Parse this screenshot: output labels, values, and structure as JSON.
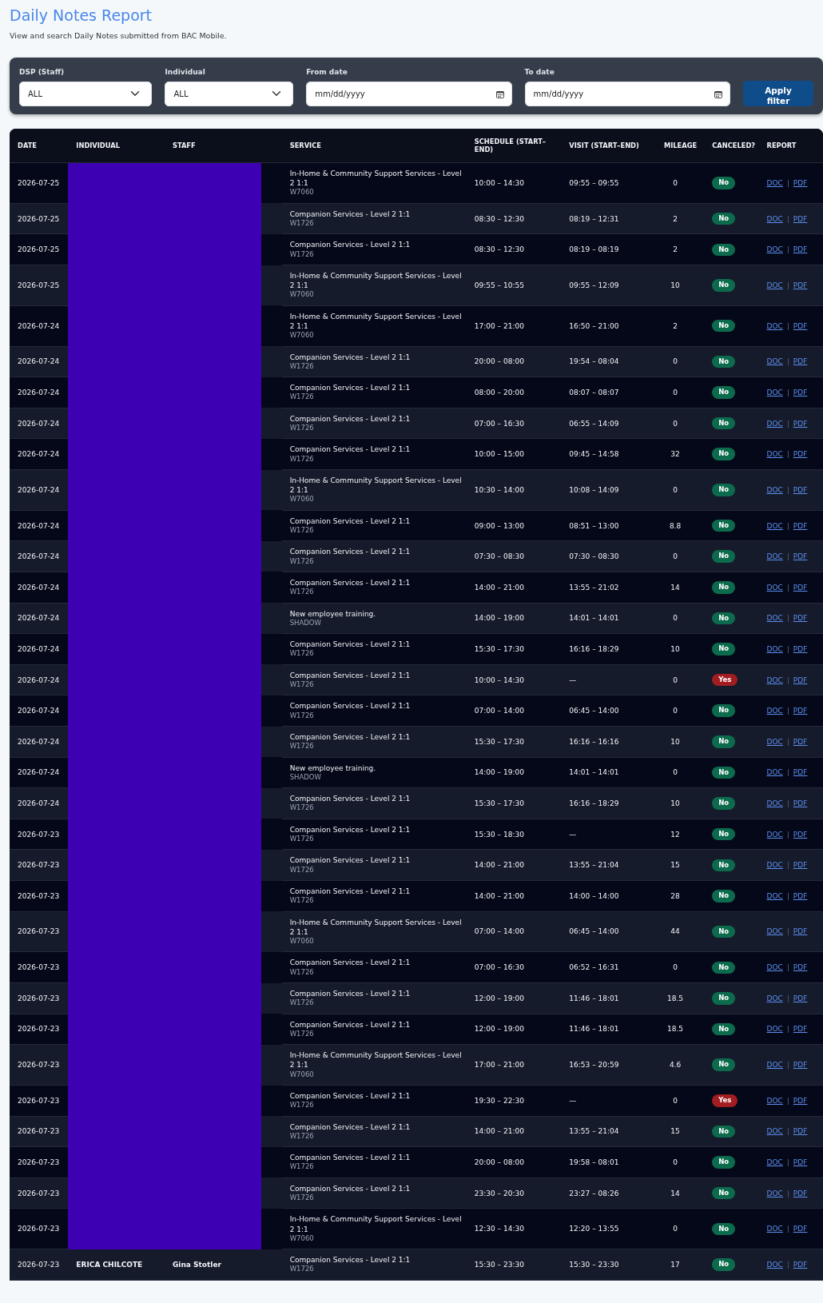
{
  "header": {
    "title": "Daily Notes Report",
    "subtitle": "View and search Daily Notes submitted from BAC Mobile."
  },
  "filters": {
    "fields": [
      {
        "kind": "select",
        "label": "DSP (Staff)",
        "value": "ALL"
      },
      {
        "kind": "select",
        "label": "Individual",
        "value": "ALL"
      },
      {
        "kind": "date",
        "label": "From date",
        "placeholder": "mm/dd/yyyy"
      },
      {
        "kind": "date",
        "label": "To date",
        "placeholder": "mm/dd/yyyy"
      }
    ],
    "button": "Apply filter"
  },
  "table": {
    "columns": [
      "DATE",
      "INDIVIDUAL",
      "STAFF",
      "SERVICE",
      "SCHEDULE (START–END)",
      "VISIT (START–END)",
      "MILEAGE",
      "CANCELED?",
      "REPORT"
    ],
    "rows": [
      {
        "date": "2026-07-25",
        "redacted": true,
        "service": "In-Home & Community Support Services - Level 2 1:1",
        "code": "W7060",
        "schedule": "10:00 – 14:30",
        "visit": "09:55 – 09:55",
        "mileage": "0",
        "canceled": false,
        "canceled_label": "No",
        "links": [
          "DOC",
          "PDF"
        ]
      },
      {
        "date": "2026-07-25",
        "redacted": true,
        "service": "Companion Services - Level 2 1:1",
        "code": "W1726",
        "schedule": "08:30 – 12:30",
        "visit": "08:19 – 12:31",
        "mileage": "2",
        "canceled": false,
        "canceled_label": "No",
        "links": [
          "DOC",
          "PDF"
        ]
      },
      {
        "date": "2026-07-25",
        "redacted": true,
        "service": "Companion Services - Level 2 1:1",
        "code": "W1726",
        "schedule": "08:30 – 12:30",
        "visit": "08:19 – 08:19",
        "mileage": "2",
        "canceled": false,
        "canceled_label": "No",
        "links": [
          "DOC",
          "PDF"
        ]
      },
      {
        "date": "2026-07-25",
        "redacted": true,
        "service": "In-Home & Community Support Services - Level 2 1:1",
        "code": "W7060",
        "schedule": "09:55 – 10:55",
        "visit": "09:55 – 12:09",
        "mileage": "10",
        "canceled": false,
        "canceled_label": "No",
        "links": [
          "DOC",
          "PDF"
        ]
      },
      {
        "date": "2026-07-24",
        "redacted": true,
        "service": "In-Home & Community Support Services - Level 2 1:1",
        "code": "W7060",
        "schedule": "17:00 – 21:00",
        "visit": "16:50 – 21:00",
        "mileage": "2",
        "canceled": false,
        "canceled_label": "No",
        "links": [
          "DOC",
          "PDF"
        ]
      },
      {
        "date": "2026-07-24",
        "redacted": true,
        "service": "Companion Services - Level 2 1:1",
        "code": "W1726",
        "schedule": "20:00 – 08:00",
        "visit": "19:54 – 08:04",
        "mileage": "0",
        "canceled": false,
        "canceled_label": "No",
        "links": [
          "DOC",
          "PDF"
        ]
      },
      {
        "date": "2026-07-24",
        "redacted": true,
        "service": "Companion Services - Level 2 1:1",
        "code": "W1726",
        "schedule": "08:00 – 20:00",
        "visit": "08:07 – 08:07",
        "mileage": "0",
        "canceled": false,
        "canceled_label": "No",
        "links": [
          "DOC",
          "PDF"
        ]
      },
      {
        "date": "2026-07-24",
        "redacted": true,
        "service": "Companion Services - Level 2 1:1",
        "code": "W1726",
        "schedule": "07:00 – 16:30",
        "visit": "06:55 – 14:09",
        "mileage": "0",
        "canceled": false,
        "canceled_label": "No",
        "links": [
          "DOC",
          "PDF"
        ]
      },
      {
        "date": "2026-07-24",
        "redacted": true,
        "service": "Companion Services - Level 2 1:1",
        "code": "W1726",
        "schedule": "10:00 – 15:00",
        "visit": "09:45 – 14:58",
        "mileage": "32",
        "canceled": false,
        "canceled_label": "No",
        "links": [
          "DOC",
          "PDF"
        ]
      },
      {
        "date": "2026-07-24",
        "redacted": true,
        "service": "In-Home & Community Support Services - Level 2 1:1",
        "code": "W7060",
        "schedule": "10:30 – 14:00",
        "visit": "10:08 – 14:09",
        "mileage": "0",
        "canceled": false,
        "canceled_label": "No",
        "links": [
          "DOC",
          "PDF"
        ]
      },
      {
        "date": "2026-07-24",
        "redacted": true,
        "service": "Companion Services - Level 2 1:1",
        "code": "W1726",
        "schedule": "09:00 – 13:00",
        "visit": "08:51 – 13:00",
        "mileage": "8.8",
        "canceled": false,
        "canceled_label": "No",
        "links": [
          "DOC",
          "PDF"
        ]
      },
      {
        "date": "2026-07-24",
        "redacted": true,
        "service": "Companion Services - Level 2 1:1",
        "code": "W1726",
        "schedule": "07:30 – 08:30",
        "visit": "07:30 – 08:30",
        "mileage": "0",
        "canceled": false,
        "canceled_label": "No",
        "links": [
          "DOC",
          "PDF"
        ]
      },
      {
        "date": "2026-07-24",
        "redacted": true,
        "service": "Companion Services - Level 2 1:1",
        "code": "W1726",
        "schedule": "14:00 – 21:00",
        "visit": "13:55 – 21:02",
        "mileage": "14",
        "canceled": false,
        "canceled_label": "No",
        "links": [
          "DOC",
          "PDF"
        ]
      },
      {
        "date": "2026-07-24",
        "redacted": true,
        "service": "New employee training.",
        "code": "SHADOW",
        "schedule": "14:00 – 19:00",
        "visit": "14:01 – 14:01",
        "mileage": "0",
        "canceled": false,
        "canceled_label": "No",
        "links": [
          "DOC",
          "PDF"
        ]
      },
      {
        "date": "2026-07-24",
        "redacted": true,
        "service": "Companion Services - Level 2 1:1",
        "code": "W1726",
        "schedule": "15:30 – 17:30",
        "visit": "16:16 – 18:29",
        "mileage": "10",
        "canceled": false,
        "canceled_label": "No",
        "links": [
          "DOC",
          "PDF"
        ]
      },
      {
        "date": "2026-07-24",
        "redacted": true,
        "service": "Companion Services - Level 2 1:1",
        "code": "W1726",
        "schedule": "10:00 – 14:30",
        "visit": "—",
        "mileage": "0",
        "canceled": true,
        "canceled_label": "Yes",
        "links": [
          "DOC",
          "PDF"
        ]
      },
      {
        "date": "2026-07-24",
        "redacted": true,
        "service": "Companion Services - Level 2 1:1",
        "code": "W1726",
        "schedule": "07:00 – 14:00",
        "visit": "06:45 – 14:00",
        "mileage": "0",
        "canceled": false,
        "canceled_label": "No",
        "links": [
          "DOC",
          "PDF"
        ]
      },
      {
        "date": "2026-07-24",
        "redacted": true,
        "service": "Companion Services - Level 2 1:1",
        "code": "W1726",
        "schedule": "15:30 – 17:30",
        "visit": "16:16 – 16:16",
        "mileage": "10",
        "canceled": false,
        "canceled_label": "No",
        "links": [
          "DOC",
          "PDF"
        ]
      },
      {
        "date": "2026-07-24",
        "redacted": true,
        "service": "New employee training.",
        "code": "SHADOW",
        "schedule": "14:00 – 19:00",
        "visit": "14:01 – 14:01",
        "mileage": "0",
        "canceled": false,
        "canceled_label": "No",
        "links": [
          "DOC",
          "PDF"
        ]
      },
      {
        "date": "2026-07-24",
        "redacted": true,
        "service": "Companion Services - Level 2 1:1",
        "code": "W1726",
        "schedule": "15:30 – 17:30",
        "visit": "16:16 – 18:29",
        "mileage": "10",
        "canceled": false,
        "canceled_label": "No",
        "links": [
          "DOC",
          "PDF"
        ]
      },
      {
        "date": "2026-07-23",
        "redacted": true,
        "service": "Companion Services - Level 2 1:1",
        "code": "W1726",
        "schedule": "15:30 – 18:30",
        "visit": "—",
        "mileage": "12",
        "canceled": false,
        "canceled_label": "No",
        "links": [
          "DOC",
          "PDF"
        ]
      },
      {
        "date": "2026-07-23",
        "redacted": true,
        "service": "Companion Services - Level 2 1:1",
        "code": "W1726",
        "schedule": "14:00 – 21:00",
        "visit": "13:55 – 21:04",
        "mileage": "15",
        "canceled": false,
        "canceled_label": "No",
        "links": [
          "DOC",
          "PDF"
        ]
      },
      {
        "date": "2026-07-23",
        "redacted": true,
        "service": "Companion Services - Level 2 1:1",
        "code": "W1726",
        "schedule": "14:00 – 21:00",
        "visit": "14:00 – 14:00",
        "mileage": "28",
        "canceled": false,
        "canceled_label": "No",
        "links": [
          "DOC",
          "PDF"
        ]
      },
      {
        "date": "2026-07-23",
        "redacted": true,
        "service": "In-Home & Community Support Services - Level 2 1:1",
        "code": "W7060",
        "schedule": "07:00 – 14:00",
        "visit": "06:45 – 14:00",
        "mileage": "44",
        "canceled": false,
        "canceled_label": "No",
        "links": [
          "DOC",
          "PDF"
        ]
      },
      {
        "date": "2026-07-23",
        "redacted": true,
        "service": "Companion Services - Level 2 1:1",
        "code": "W1726",
        "schedule": "07:00 – 16:30",
        "visit": "06:52 – 16:31",
        "mileage": "0",
        "canceled": false,
        "canceled_label": "No",
        "links": [
          "DOC",
          "PDF"
        ]
      },
      {
        "date": "2026-07-23",
        "redacted": true,
        "service": "Companion Services - Level 2 1:1",
        "code": "W1726",
        "schedule": "12:00 – 19:00",
        "visit": "11:46 – 18:01",
        "mileage": "18.5",
        "canceled": false,
        "canceled_label": "No",
        "links": [
          "DOC",
          "PDF"
        ]
      },
      {
        "date": "2026-07-23",
        "redacted": true,
        "service": "Companion Services - Level 2 1:1",
        "code": "W1726",
        "schedule": "12:00 – 19:00",
        "visit": "11:46 – 18:01",
        "mileage": "18.5",
        "canceled": false,
        "canceled_label": "No",
        "links": [
          "DOC",
          "PDF"
        ]
      },
      {
        "date": "2026-07-23",
        "redacted": true,
        "service": "In-Home & Community Support Services - Level 2 1:1",
        "code": "W7060",
        "schedule": "17:00 – 21:00",
        "visit": "16:53 – 20:59",
        "mileage": "4.6",
        "canceled": false,
        "canceled_label": "No",
        "links": [
          "DOC",
          "PDF"
        ]
      },
      {
        "date": "2026-07-23",
        "redacted": true,
        "service": "Companion Services - Level 2 1:1",
        "code": "W1726",
        "schedule": "19:30 – 22:30",
        "visit": "—",
        "mileage": "0",
        "canceled": true,
        "canceled_label": "Yes",
        "links": [
          "DOC",
          "PDF"
        ]
      },
      {
        "date": "2026-07-23",
        "redacted": true,
        "service": "Companion Services - Level 2 1:1",
        "code": "W1726",
        "schedule": "14:00 – 21:00",
        "visit": "13:55 – 21:04",
        "mileage": "15",
        "canceled": false,
        "canceled_label": "No",
        "links": [
          "DOC",
          "PDF"
        ]
      },
      {
        "date": "2026-07-23",
        "redacted": true,
        "service": "Companion Services - Level 2 1:1",
        "code": "W1726",
        "schedule": "20:00 – 08:00",
        "visit": "19:58 – 08:01",
        "mileage": "0",
        "canceled": false,
        "canceled_label": "No",
        "links": [
          "DOC",
          "PDF"
        ]
      },
      {
        "date": "2026-07-23",
        "redacted": true,
        "service": "Companion Services - Level 2 1:1",
        "code": "W1726",
        "schedule": "23:30 – 20:30",
        "visit": "23:27 – 08:26",
        "mileage": "14",
        "canceled": false,
        "canceled_label": "No",
        "links": [
          "DOC",
          "PDF"
        ]
      },
      {
        "date": "2026-07-23",
        "redacted": true,
        "service": "In-Home & Community Support Services - Level 2 1:1",
        "code": "W7060",
        "schedule": "12:30 – 14:30",
        "visit": "12:20 – 13:55",
        "mileage": "0",
        "canceled": false,
        "canceled_label": "No",
        "links": [
          "DOC",
          "PDF"
        ]
      },
      {
        "date": "2026-07-23",
        "redacted": false,
        "individual": "ERICA CHILCOTE",
        "staff": "Gina Stotler",
        "service": "Companion Services - Level 2 1:1",
        "code": "W1726",
        "schedule": "15:30 – 23:30",
        "visit": "15:30 – 23:30",
        "mileage": "17",
        "canceled": false,
        "canceled_label": "No",
        "links": [
          "DOC",
          "PDF"
        ]
      }
    ]
  }
}
